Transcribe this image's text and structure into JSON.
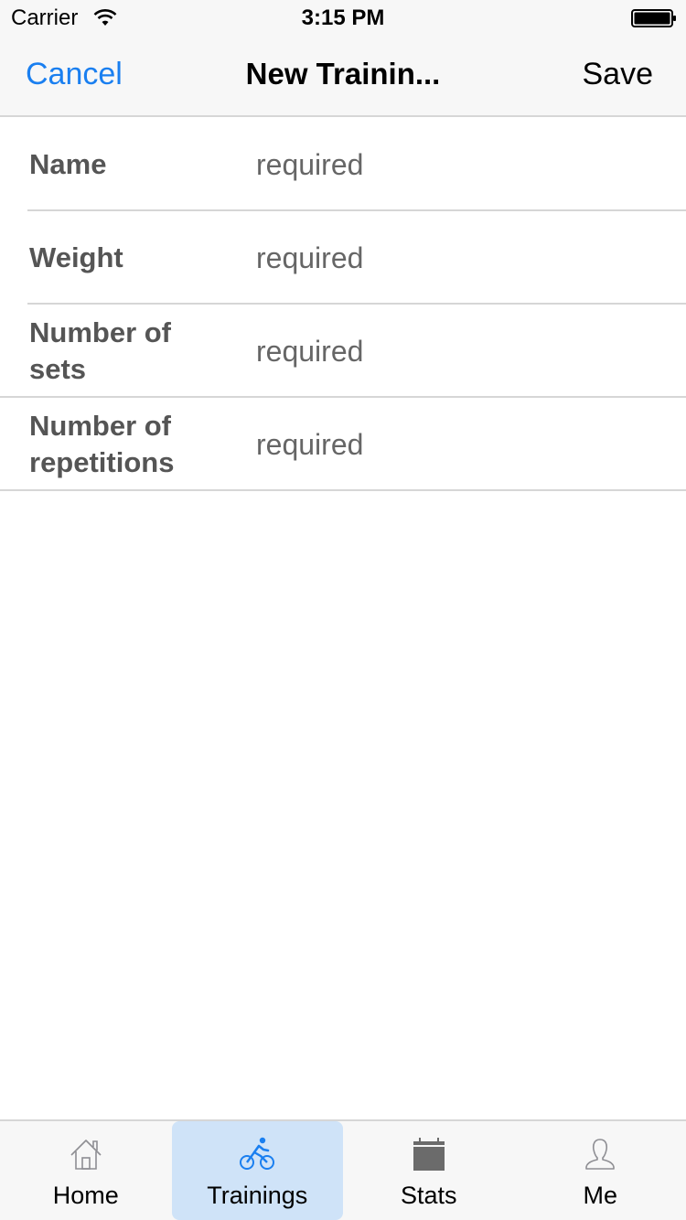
{
  "status_bar": {
    "carrier": "Carrier",
    "time": "3:15 PM"
  },
  "nav": {
    "cancel_label": "Cancel",
    "title": "New Trainin...",
    "save_label": "Save",
    "accent_color": "#1a7ff0"
  },
  "form": {
    "rows": [
      {
        "label": "Name",
        "placeholder": "required"
      },
      {
        "label": "Weight",
        "placeholder": "required"
      },
      {
        "label": "Number of sets",
        "placeholder": "required"
      },
      {
        "label": "Number of repetitions",
        "placeholder": "required"
      }
    ]
  },
  "tab_bar": {
    "tabs": [
      {
        "label": "Home",
        "icon": "home-icon"
      },
      {
        "label": "Trainings",
        "icon": "bicycle-icon",
        "selected": true
      },
      {
        "label": "Stats",
        "icon": "calendar-icon"
      },
      {
        "label": "Me",
        "icon": "person-icon"
      }
    ],
    "selected_color": "#cfe3f8"
  }
}
